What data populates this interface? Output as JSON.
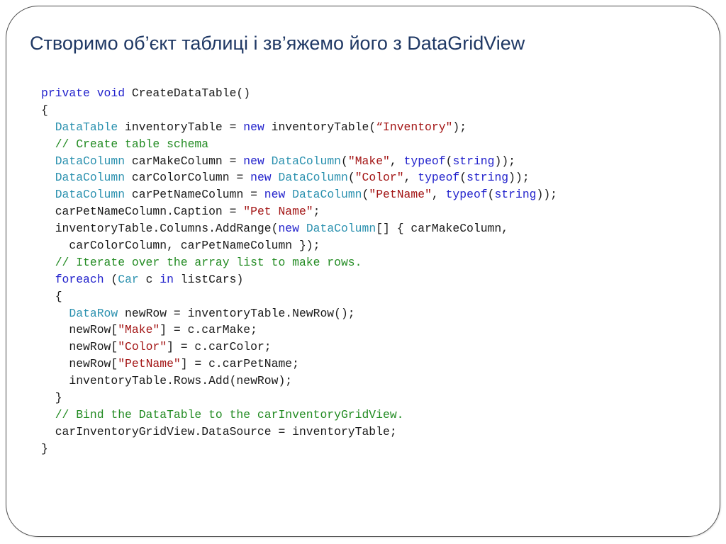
{
  "title": "Створимо об’єкт таблиці і зв’яжемо його з DataGridView",
  "colors": {
    "title": "#1f3864",
    "keyword": "#2222cc",
    "type": "#2b91af",
    "string": "#a31515",
    "comment": "#228b22",
    "text": "#1a1a1a"
  },
  "code": {
    "language": "C#",
    "lines": [
      {
        "indent": 0,
        "tokens": [
          [
            "kw",
            "private void"
          ],
          [
            "txt",
            " CreateDataTable()"
          ]
        ]
      },
      {
        "indent": 0,
        "tokens": [
          [
            "txt",
            "{"
          ]
        ]
      },
      {
        "indent": 1,
        "tokens": [
          [
            "type",
            "DataTable"
          ],
          [
            "txt",
            " inventoryTable = "
          ],
          [
            "kw",
            "new"
          ],
          [
            "txt",
            " inventoryTable("
          ],
          [
            "str",
            "“Inventory\""
          ],
          [
            "txt",
            ");"
          ]
        ]
      },
      {
        "indent": 1,
        "tokens": [
          [
            "cm",
            "// Create table schema"
          ]
        ]
      },
      {
        "indent": 1,
        "tokens": [
          [
            "type",
            "DataColumn"
          ],
          [
            "txt",
            " carMakeColumn = "
          ],
          [
            "kw",
            "new"
          ],
          [
            "txt",
            " "
          ],
          [
            "type",
            "DataColumn"
          ],
          [
            "txt",
            "("
          ],
          [
            "str",
            "\"Make\""
          ],
          [
            "txt",
            ", "
          ],
          [
            "kw",
            "typeof"
          ],
          [
            "txt",
            "("
          ],
          [
            "kw",
            "string"
          ],
          [
            "txt",
            "));"
          ]
        ]
      },
      {
        "indent": 1,
        "tokens": [
          [
            "type",
            "DataColumn"
          ],
          [
            "txt",
            " carColorColumn = "
          ],
          [
            "kw",
            "new"
          ],
          [
            "txt",
            " "
          ],
          [
            "type",
            "DataColumn"
          ],
          [
            "txt",
            "("
          ],
          [
            "str",
            "\"Color\""
          ],
          [
            "txt",
            ", "
          ],
          [
            "kw",
            "typeof"
          ],
          [
            "txt",
            "("
          ],
          [
            "kw",
            "string"
          ],
          [
            "txt",
            "));"
          ]
        ]
      },
      {
        "indent": 1,
        "tokens": [
          [
            "type",
            "DataColumn"
          ],
          [
            "txt",
            " carPetNameColumn = "
          ],
          [
            "kw",
            "new"
          ],
          [
            "txt",
            " "
          ],
          [
            "type",
            "DataColumn"
          ],
          [
            "txt",
            "("
          ],
          [
            "str",
            "\"PetName\""
          ],
          [
            "txt",
            ", "
          ],
          [
            "kw",
            "typeof"
          ],
          [
            "txt",
            "("
          ],
          [
            "kw",
            "string"
          ],
          [
            "txt",
            "));"
          ]
        ]
      },
      {
        "indent": 1,
        "tokens": [
          [
            "txt",
            "carPetNameColumn.Caption = "
          ],
          [
            "str",
            "\"Pet Name\""
          ],
          [
            "txt",
            ";"
          ]
        ]
      },
      {
        "indent": 1,
        "tokens": [
          [
            "txt",
            "inventoryTable.Columns.AddRange("
          ],
          [
            "kw",
            "new"
          ],
          [
            "txt",
            " "
          ],
          [
            "type",
            "DataColumn"
          ],
          [
            "txt",
            "[] { carMakeColumn,"
          ]
        ]
      },
      {
        "indent": 2,
        "tokens": [
          [
            "txt",
            "carColorColumn, carPetNameColumn });"
          ]
        ]
      },
      {
        "indent": 1,
        "tokens": [
          [
            "cm",
            "// Iterate over the array list to make rows."
          ]
        ]
      },
      {
        "indent": 1,
        "tokens": [
          [
            "kw",
            "foreach"
          ],
          [
            "txt",
            " ("
          ],
          [
            "type",
            "Car"
          ],
          [
            "txt",
            " c "
          ],
          [
            "kw",
            "in"
          ],
          [
            "txt",
            " listCars)"
          ]
        ]
      },
      {
        "indent": 1,
        "tokens": [
          [
            "txt",
            "{"
          ]
        ]
      },
      {
        "indent": 2,
        "tokens": [
          [
            "type",
            "DataRow"
          ],
          [
            "txt",
            " newRow = inventoryTable.NewRow();"
          ]
        ]
      },
      {
        "indent": 2,
        "tokens": [
          [
            "txt",
            "newRow["
          ],
          [
            "str",
            "\"Make\""
          ],
          [
            "txt",
            "] = c.carMake;"
          ]
        ]
      },
      {
        "indent": 2,
        "tokens": [
          [
            "txt",
            "newRow["
          ],
          [
            "str",
            "\"Color\""
          ],
          [
            "txt",
            "] = c.carColor;"
          ]
        ]
      },
      {
        "indent": 2,
        "tokens": [
          [
            "txt",
            "newRow["
          ],
          [
            "str",
            "\"PetName\""
          ],
          [
            "txt",
            "] = c.carPetName;"
          ]
        ]
      },
      {
        "indent": 2,
        "tokens": [
          [
            "txt",
            "inventoryTable.Rows.Add(newRow);"
          ]
        ]
      },
      {
        "indent": 1,
        "tokens": [
          [
            "txt",
            "}"
          ]
        ]
      },
      {
        "indent": 1,
        "tokens": [
          [
            "cm",
            "// Bind the DataTable to the carInventoryGridView."
          ]
        ]
      },
      {
        "indent": 1,
        "tokens": [
          [
            "txt",
            "carInventoryGridView.DataSource = inventoryTable;"
          ]
        ]
      },
      {
        "indent": 0,
        "tokens": [
          [
            "txt",
            "}"
          ]
        ]
      }
    ]
  }
}
